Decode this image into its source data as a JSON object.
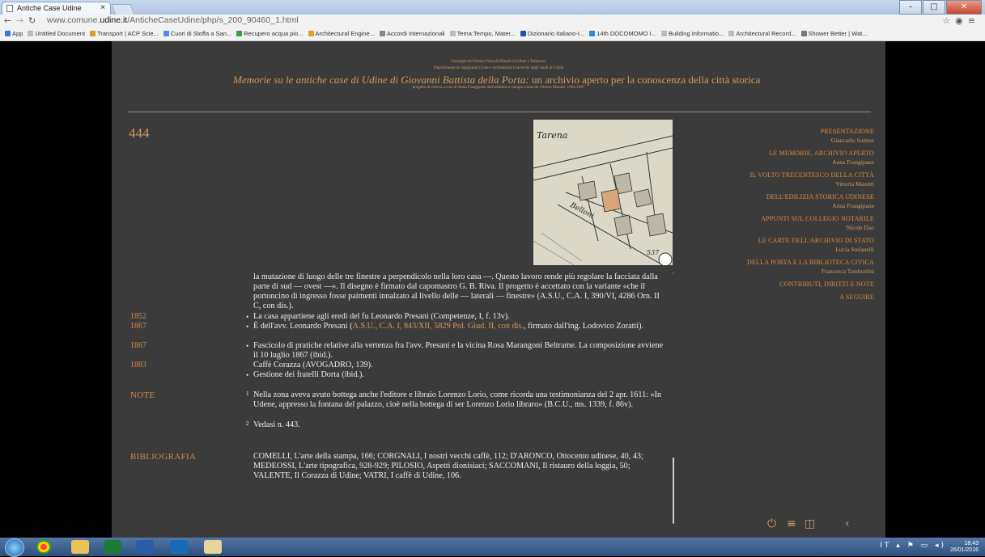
{
  "browser": {
    "tab_title": "Antiche Case Udine",
    "tab_close": "×",
    "url_prefix": "www.comune.",
    "url_host": "udine.it",
    "url_path": "/AnticheCaseUdine/php/s_200_90460_1.html",
    "bookmarks": [
      {
        "label": "App",
        "color": "#3b7bd4"
      },
      {
        "label": "Untitled Document",
        "color": "#bbbbbb"
      },
      {
        "label": "Transport | ACP Scie...",
        "color": "#d8a020"
      },
      {
        "label": "Cuori di Stoffa a San...",
        "color": "#4a90e2"
      },
      {
        "label": "Recupero acqua pio...",
        "color": "#3aa043"
      },
      {
        "label": "Architectural Engine...",
        "color": "#e0a030"
      },
      {
        "label": "Accordi Internazionali",
        "color": "#888888"
      },
      {
        "label": "Tema:Tempo, Mater...",
        "color": "#bbbbbb"
      },
      {
        "label": "Dizionario Italiano-I...",
        "color": "#2255aa"
      },
      {
        "label": "14th DOCOMOMO I...",
        "color": "#2a8cd8"
      },
      {
        "label": "Building Informatio...",
        "color": "#bbbbbb"
      },
      {
        "label": "Architectural Record...",
        "color": "#bbbbbb"
      },
      {
        "label": "Shower Better | Wat...",
        "color": "#777777"
      }
    ]
  },
  "header": {
    "line1": "Consiglio dei Dottori Notarili Riuniti di Udine e Tolmezzo",
    "line2": "Dipartimento di Ingegneria Civile e Architettura Università degli Studi di Udine",
    "title_em": "Memorie su le antiche case di Udine di Giovanni Battista della Porta:",
    "title_rest": " un archivio aperto per la conoscenza della città storica",
    "line4": "progetto di ricerca a cura di Anna Frangipane dall'edizione a stampa curata da Vittoria Masutti, 1984-1987"
  },
  "record_number": "444",
  "map_labels": [
    "Tarena",
    "Belloni",
    "537"
  ],
  "nav": [
    {
      "title": "PRESENTAZIONE",
      "author": "Giancarlo Suitner"
    },
    {
      "title": "LE MEMORIE, ARCHIVIO APERTO",
      "author": "Anna Frangipane"
    },
    {
      "title": "IL VOLTO TRECENTESCO DELLA CITTÀ",
      "author": "Vittoria Masutti"
    },
    {
      "title": "DELL'EDILIZIA STORICA UDINESE",
      "author": "Anna Frangipane"
    },
    {
      "title": "APPUNTI SUL COLLEGIO NOTARILE",
      "author": "Nicole Dao"
    },
    {
      "title": "LE CARTE DELL'ARCHIVIO DI STATO",
      "author": "Lucia Stefanelli"
    },
    {
      "title": "DELLA PORTA E LA BIBLIOTECA CIVICA",
      "author": "Francesca Tamburlini"
    },
    {
      "title": "CONTRIBUTI, DIRITTI E NOTE",
      "author": ""
    },
    {
      "title": "A SEGUIRE",
      "author": ""
    }
  ],
  "content": {
    "intro": "la mutazione di luogo delle tre finestre a perpendicolo nella loro casa —. Questo lavoro rende più regolare la facciata dalla parte di sud — ovest —». Il disegno è firmato dal capomastro G. B. Riva. Il progetto è accettato con la variante «che il portoncino di ingresso fosse paimenti innalzato al livello delle — laterali — finestre» (A.S.U., C.A. I, 390/VI, 4286 Orn. II C, con dis.).",
    "y1852": "1852",
    "t1852": "La casa appartiene agli eredi del fu Leonardo Presani (Competenze, I, f. 13v).",
    "y1867a": "1867",
    "t1867a_a": "È dell'avv. Leonardo Presani (",
    "t1867a_b": "A.S.U., C.A. I, 843/XII, 5829 Pol. Giud. II, con dis.",
    "t1867a_c": ", firmato dall'ing. Lodovico Zoratti).",
    "y1867b": "1867",
    "t1867b": "Fascicolo di pratiche relative alla vertenza fra l'avv. Presani e la vicina Rosa Marangoni Beltrame. La composizione avviene il 10 luglio 1867 (ibid.).",
    "y1883": "1883",
    "t1883": "Caffè Corazza (AVOGADRO, 139).",
    "t_dorta": "Gestione dei fratelli Dorta (ibid.).",
    "bullet": "•",
    "note_label": "NOTE",
    "note1_mark": "1",
    "note1": "Nella zona aveva avuto bottega anche l'editore e libraio Lorenzo Lorio, come ricorda una testimonianza del 2 apr. 1611: «In Udene, appresso la fontana del palazzo, cioè nella bottega di ser Lorenzo Lorio libraro» (B.C.U., ms. 1339, f. 86v).",
    "note2_mark": "2",
    "note2": "Vedasi n. 443.",
    "biblio_label": "BIBLIOGRAFIA",
    "biblio": "COMELLI, L'arte della stampa, 166; CORGNALI, I nostri vecchi caffè, 112; D'ARONCO, Ottocento udinese, 40, 43; MEDEOSSI, L'arte tipografica, 928-929; PILOSIO, Aspetti dionisiaci; SACCOMANI, Il ristauro della loggia, 50; VALENTE, Il Corazza di Udine; VATRI, I caffè di Udine, 106."
  },
  "controls": {
    "power": "⏻",
    "menu": "≡",
    "columns": "◫",
    "back": "‹"
  },
  "taskbar": {
    "time": "18:43",
    "date": "26/01/2016",
    "lang": "IT"
  },
  "colors": {
    "accent": "#d29a5c",
    "nav_title": "#e08a3c",
    "page_bg": "#3b3b3b"
  }
}
